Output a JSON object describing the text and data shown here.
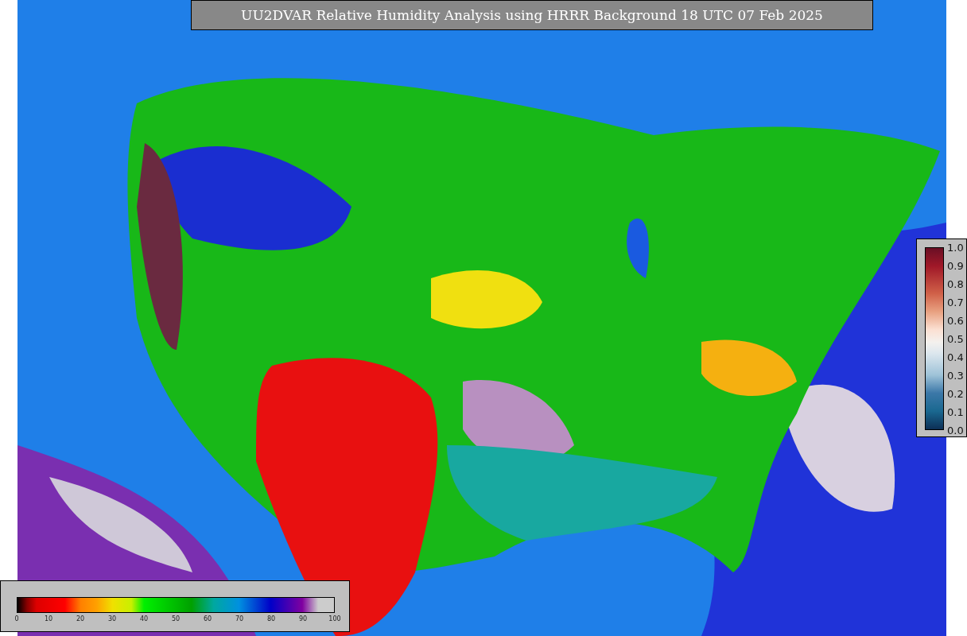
{
  "title": "UU2DVAR Relative Humidity Analysis using HRRR Background 18 UTC 07 Feb 2025",
  "humidity_colorbar": {
    "ticks": [
      "0",
      "10",
      "20",
      "30",
      "40",
      "50",
      "60",
      "70",
      "80",
      "90",
      "100"
    ]
  },
  "ratio_colorbar": {
    "ticks": [
      "1.0",
      "0.9",
      "0.8",
      "0.7",
      "0.6",
      "0.5",
      "0.4",
      "0.3",
      "0.2",
      "0.1",
      "0.0"
    ]
  }
}
